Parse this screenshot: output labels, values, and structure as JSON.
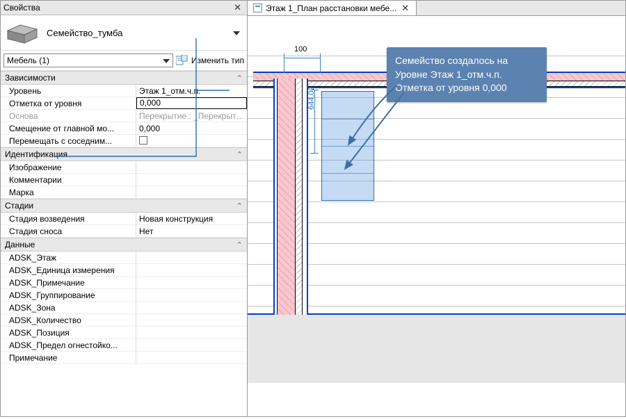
{
  "panel": {
    "title": "Свойства",
    "family_name": "Семейство_тумба",
    "type_selector": "Мебель (1)",
    "edit_type": "Изменить тип",
    "sections": {
      "constraints": "Зависимости",
      "identity": "Идентификация",
      "phasing": "Стадии",
      "data": "Данные"
    },
    "rows": {
      "level_label": "Уровень",
      "level_value": "Этаж 1_отм.ч.п.",
      "elev_label": "Отметка от уровня",
      "elev_value": "0,000",
      "host_label": "Основа",
      "host_value": "Перекрытие : _Перекрыти...",
      "offset_label": "Смещение от главной мо...",
      "offset_value": "0,000",
      "moves_label": "Перемещать с соседним...",
      "image_label": "Изображение",
      "comments_label": "Комментарии",
      "mark_label": "Марка",
      "phase_created_label": "Стадия возведения",
      "phase_created_value": "Новая конструкция",
      "phase_demolished_label": "Стадия сноса",
      "phase_demolished_value": "Нет",
      "adsk_floor": "ADSK_Этаж",
      "adsk_unit": "ADSK_Единица измерения",
      "adsk_note": "ADSK_Примечание",
      "adsk_group": "ADSK_Группирование",
      "adsk_zone": "ADSK_Зона",
      "adsk_qty": "ADSK_Количество",
      "adsk_pos": "ADSK_Позиция",
      "adsk_fire": "ADSK_Предел огнестойко...",
      "adsk_note2": "Примечание"
    }
  },
  "canvas": {
    "tab_title": "Этаж 1_План расстановки мебе...",
    "dim_horizontal": "100",
    "dim_vertical": "644,02",
    "callout_line1": "Семейство создалось на",
    "callout_line2": "Уровне Этаж 1_отм.ч.п.",
    "callout_line3": "Отметка от уровня 0,000"
  }
}
